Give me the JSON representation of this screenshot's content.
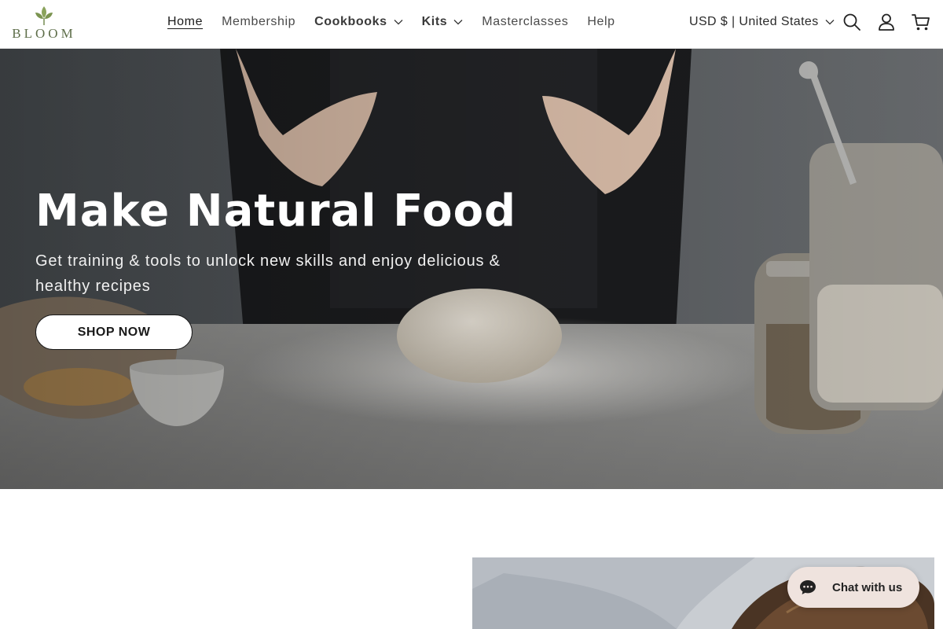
{
  "brand": {
    "name": "BLOOM",
    "accent": "#5e6e4a"
  },
  "nav": {
    "items": [
      {
        "label": "Home",
        "active": true,
        "dropdown": false
      },
      {
        "label": "Membership",
        "active": false,
        "dropdown": false
      },
      {
        "label": "Cookbooks",
        "active": false,
        "dropdown": true
      },
      {
        "label": "Kits",
        "active": false,
        "dropdown": true
      },
      {
        "label": "Masterclasses",
        "active": false,
        "dropdown": false
      },
      {
        "label": "Help",
        "active": false,
        "dropdown": false
      }
    ]
  },
  "header": {
    "currency_label": "USD $ | United States",
    "icons": [
      "search-icon",
      "account-icon",
      "cart-icon"
    ]
  },
  "hero": {
    "title": "Make Natural Food",
    "subtitle": "Get training & tools to unlock new skills and enjoy delicious & healthy recipes",
    "cta_label": "SHOP NOW"
  },
  "chat": {
    "label": "Chat with us",
    "icon": "chat-bubble-icon",
    "color": "#efe3de"
  }
}
